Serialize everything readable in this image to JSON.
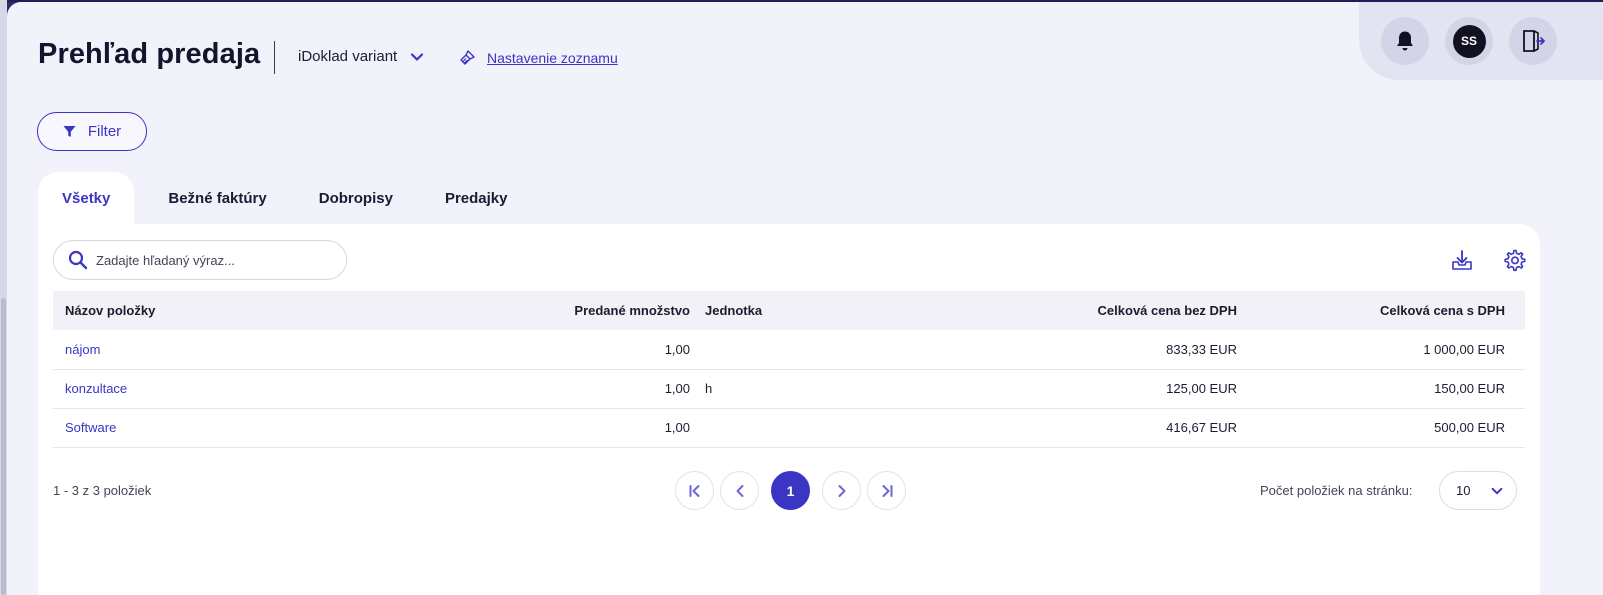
{
  "header": {
    "title": "Prehľad predaja",
    "variant_label": "iDoklad variant",
    "settings_link": "Nastavenie zoznamu"
  },
  "user": {
    "initials": "SS"
  },
  "filter": {
    "label": "Filter"
  },
  "tabs": [
    {
      "label": "Všetky",
      "active": true
    },
    {
      "label": "Bežné faktúry"
    },
    {
      "label": "Dobropisy"
    },
    {
      "label": "Predajky"
    }
  ],
  "search": {
    "placeholder": "Zadajte hľadaný výraz..."
  },
  "table": {
    "columns": [
      "Názov položky",
      "Predané množstvo",
      "Jednotka",
      "Celková cena bez DPH",
      "Celková cena s DPH"
    ],
    "rows": [
      {
        "name": "nájom",
        "qty": "1,00",
        "unit": "",
        "net": "833,33 EUR",
        "gross": "1 000,00 EUR"
      },
      {
        "name": "konzultace",
        "qty": "1,00",
        "unit": "h",
        "net": "125,00 EUR",
        "gross": "150,00 EUR"
      },
      {
        "name": "Software",
        "qty": "1,00",
        "unit": "",
        "net": "416,67 EUR",
        "gross": "500,00 EUR"
      }
    ]
  },
  "footer": {
    "count": "1 - 3 z 3 položiek",
    "current_page": "1",
    "per_page_label": "Počet položiek na stránku:",
    "per_page_value": "10"
  },
  "colors": {
    "accent": "#3b35c4",
    "background": "#f2f2fa"
  }
}
